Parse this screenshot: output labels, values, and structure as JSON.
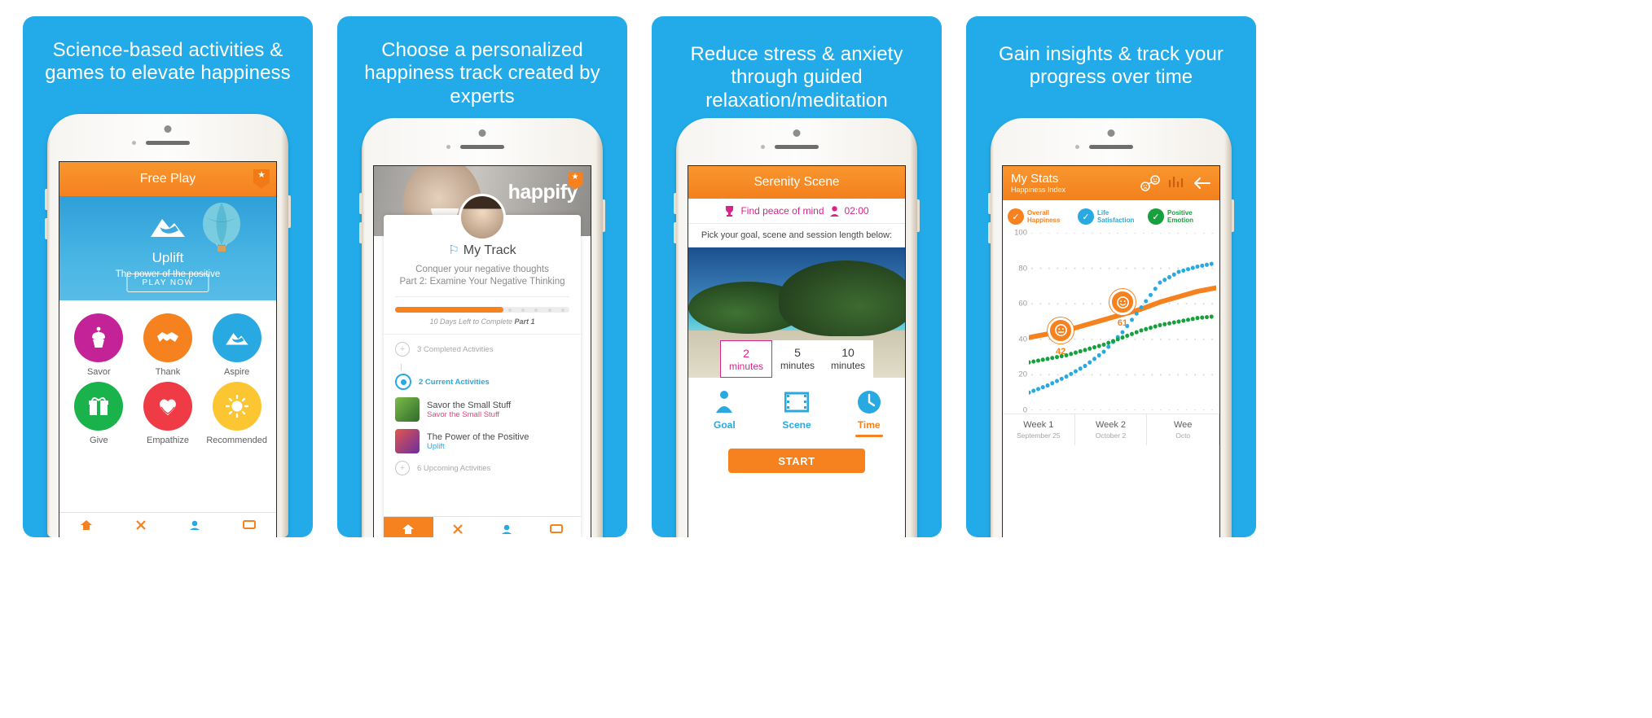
{
  "panels": [
    {
      "caption": "Science-based activities & games to elevate happiness",
      "navbar_title": "Free Play",
      "shield_icon": "shield-badge-icon",
      "hero": {
        "title": "Uplift",
        "subtitle": "The power of the positive",
        "button": "PLAY NOW",
        "mountain_icon": "mountain-icon",
        "balloon_icon": "hot-air-balloon-icon"
      },
      "tiles": [
        {
          "label": "Savor",
          "color": "#C32397",
          "icon": "cupcake-icon"
        },
        {
          "label": "Thank",
          "color": "#F5811F",
          "icon": "handshake-icon"
        },
        {
          "label": "Aspire",
          "color": "#29A9E1",
          "icon": "mountain-icon"
        },
        {
          "label": "Give",
          "color": "#19B24B",
          "icon": "gift-icon"
        },
        {
          "label": "Empathize",
          "color": "#EE3B45",
          "icon": "heart-hands-icon"
        },
        {
          "label": "Recommended",
          "color": "#FCC633",
          "icon": "sun-icon"
        }
      ]
    },
    {
      "caption": "Choose a personalized happiness track created by experts",
      "logo": "happify",
      "star_icon": "star-badge-icon",
      "track_title": "My Track",
      "flag_icon": "flag-icon",
      "track_line1": "Conquer your negative thoughts",
      "track_line2": "Part 2: Examine Your Negative Thinking",
      "progress_percent": 62,
      "progress_label_italic": "10 Days Left to Complete ",
      "progress_label_bold": "Part 1",
      "rows": [
        {
          "type": "status",
          "text": "3 Completed Activities",
          "state": "done"
        },
        {
          "type": "status",
          "text": "2 Current Activities",
          "state": "current"
        },
        {
          "type": "activity",
          "title": "Savor the Small Stuff",
          "sub": "Savor the Small Stuff",
          "sub_color": "#E0457B"
        },
        {
          "type": "activity",
          "title": "The Power of the Positive",
          "sub": "Uplift",
          "sub_color": "#29A9E1"
        },
        {
          "type": "status",
          "text": "6 Upcoming Activities",
          "state": "upcoming"
        }
      ]
    },
    {
      "caption": "Reduce stress & anxiety through guided relaxation/meditation",
      "navbar_title": "Serenity Scene",
      "goal_text": "Find peace of mind",
      "goal_icon": "trophy-icon",
      "person_icon": "person-icon",
      "timer": "02:00",
      "instruction": "Pick your goal, scene and session length below:",
      "durations": [
        {
          "n": "2",
          "unit": "minutes",
          "selected": true
        },
        {
          "n": "5",
          "unit": "minutes",
          "selected": false
        },
        {
          "n": "10",
          "unit": "minutes",
          "selected": false
        }
      ],
      "tabs": [
        {
          "label": "Goal",
          "color": "#29A9E1",
          "icon": "person-target-icon",
          "active": false
        },
        {
          "label": "Scene",
          "color": "#29A9E1",
          "icon": "film-icon",
          "active": false
        },
        {
          "label": "Time",
          "color": "#F5811F",
          "icon": "clock-icon",
          "active": true
        }
      ],
      "start_button": "START"
    },
    {
      "caption": "Gain insights & track your progress over time",
      "navbar_title": "My Stats",
      "navbar_sub": "Happiness Index",
      "nav_icons": [
        "faces-compare-icon",
        "bar-chart-icon",
        "arrow-left-icon"
      ],
      "legend": [
        {
          "label1": "Overall",
          "label2": "Happiness",
          "color": "#F5811F"
        },
        {
          "label1": "Life",
          "label2": "Satisfaction",
          "color": "#29A9E1"
        },
        {
          "label1": "Positive",
          "label2": "Emotion",
          "color": "#19A03E"
        }
      ],
      "markers": [
        {
          "value": "42",
          "x_pct": 17,
          "y_val": 45,
          "face": "neutral-face-icon"
        },
        {
          "value": "61",
          "x_pct": 50,
          "y_val": 61,
          "face": "smile-face-icon"
        }
      ],
      "weeks": [
        {
          "name": "Week 1",
          "date": "September 25"
        },
        {
          "name": "Week 2",
          "date": "October 2"
        },
        {
          "name": "Wee",
          "date": "Octo"
        }
      ]
    }
  ],
  "chart_data": {
    "type": "line",
    "title": "Happiness Index",
    "xlabel": "",
    "ylabel": "",
    "ylim": [
      0,
      100
    ],
    "yticks": [
      0,
      20,
      40,
      60,
      80,
      100
    ],
    "grid": true,
    "legend_position": "top",
    "categories": [
      "Week 1",
      "Week 2",
      "Wee"
    ],
    "x": [
      0,
      10,
      20,
      30,
      40,
      50,
      60,
      70,
      80,
      90,
      100
    ],
    "series": [
      {
        "name": "Overall Happiness",
        "color": "#F5811F",
        "style": "solid",
        "values": [
          41,
          43,
          45,
          48,
          51,
          54,
          57,
          61,
          64,
          67,
          69
        ]
      },
      {
        "name": "Life Satisfaction",
        "color": "#29A9E1",
        "style": "dotted",
        "values": [
          10,
          14,
          19,
          25,
          33,
          44,
          58,
          72,
          78,
          81,
          83
        ]
      },
      {
        "name": "Positive Emotion",
        "color": "#19A03E",
        "style": "dotted",
        "values": [
          27,
          29,
          31,
          34,
          37,
          41,
          45,
          48,
          50,
          52,
          53
        ]
      }
    ]
  }
}
